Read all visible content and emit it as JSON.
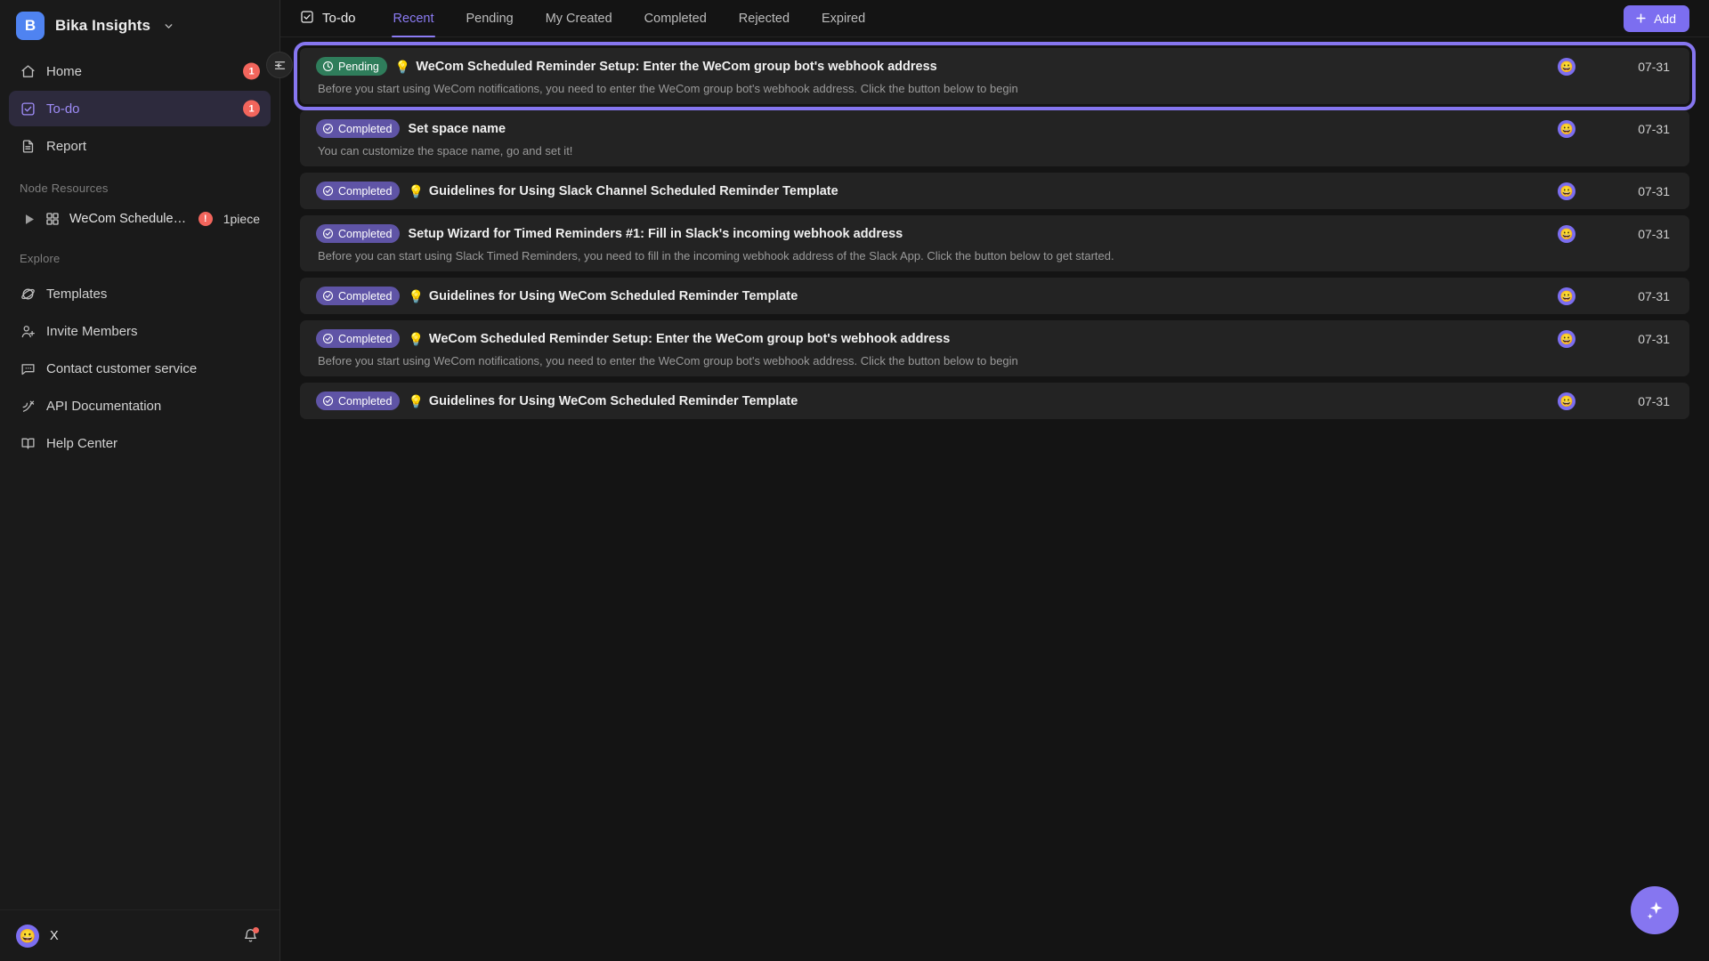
{
  "workspace": {
    "logo_letter": "B",
    "name": "Bika Insights",
    "caret_icon": "chevron-down-icon"
  },
  "sidebar": {
    "nav": [
      {
        "label": "Home",
        "icon": "home-icon",
        "badge": "1",
        "active": false
      },
      {
        "label": "To-do",
        "icon": "checkbox-icon",
        "badge": "1",
        "active": true
      },
      {
        "label": "Report",
        "icon": "document-icon",
        "badge": "",
        "active": false
      }
    ],
    "node_resources": {
      "label": "Node Resources",
      "items": [
        {
          "name": "WeCom Scheduled...",
          "alert": "!",
          "count": "1piece",
          "caret_icon": "caret-right-icon",
          "icon": "grid-icon"
        }
      ]
    },
    "explore": {
      "label": "Explore",
      "items": [
        {
          "label": "Templates",
          "icon": "template-icon"
        },
        {
          "label": "Invite Members",
          "icon": "user-plus-icon"
        },
        {
          "label": "Contact customer service",
          "icon": "chat-icon"
        },
        {
          "label": "API Documentation",
          "icon": "api-icon"
        },
        {
          "label": "Help Center",
          "icon": "book-icon"
        }
      ]
    },
    "user": {
      "avatar_emoji": "😀",
      "name": "X",
      "bell_icon": "bell-icon",
      "has_notification": true
    },
    "collapse_icon": "collapse-sidebar-icon"
  },
  "topbar": {
    "title": "To-do",
    "title_icon": "checkbox-icon",
    "tabs": [
      {
        "label": "Recent",
        "active": true
      },
      {
        "label": "Pending",
        "active": false
      },
      {
        "label": "My Created",
        "active": false
      },
      {
        "label": "Completed",
        "active": false
      },
      {
        "label": "Rejected",
        "active": false
      },
      {
        "label": "Expired",
        "active": false
      }
    ],
    "add_label": "Add",
    "add_icon": "plus-icon"
  },
  "tasks": [
    {
      "status": "Pending",
      "status_type": "pending",
      "emoji": "💡",
      "title": "WeCom Scheduled Reminder Setup: Enter the WeCom group bot's webhook address",
      "desc": "Before you start using WeCom notifications, you need to enter the WeCom group bot's webhook address. Click the button below to begin",
      "avatar_emoji": "😀",
      "date": "07-31",
      "highlighted": true
    },
    {
      "status": "Completed",
      "status_type": "completed",
      "emoji": "",
      "title": "Set space name",
      "desc": "You can customize the space name, go and set it!",
      "avatar_emoji": "😀",
      "date": "07-31",
      "highlighted": false
    },
    {
      "status": "Completed",
      "status_type": "completed",
      "emoji": "💡",
      "title": "Guidelines for Using Slack Channel Scheduled Reminder Template",
      "desc": "",
      "avatar_emoji": "😀",
      "date": "07-31",
      "highlighted": false
    },
    {
      "status": "Completed",
      "status_type": "completed",
      "emoji": "",
      "title": "Setup Wizard for Timed Reminders #1: Fill in Slack's incoming webhook address",
      "desc": "Before you can start using Slack Timed Reminders, you need to fill in the incoming webhook address of the Slack App. Click the button below to get started.",
      "avatar_emoji": "😀",
      "date": "07-31",
      "highlighted": false
    },
    {
      "status": "Completed",
      "status_type": "completed",
      "emoji": "💡",
      "title": "Guidelines for Using WeCom Scheduled Reminder Template",
      "desc": "",
      "avatar_emoji": "😀",
      "date": "07-31",
      "highlighted": false
    },
    {
      "status": "Completed",
      "status_type": "completed",
      "emoji": "💡",
      "title": "WeCom Scheduled Reminder Setup: Enter the WeCom group bot's webhook address",
      "desc": "Before you start using WeCom notifications, you need to enter the WeCom group bot's webhook address. Click the button below to begin",
      "avatar_emoji": "😀",
      "date": "07-31",
      "highlighted": false
    },
    {
      "status": "Completed",
      "status_type": "completed",
      "emoji": "💡",
      "title": "Guidelines for Using WeCom Scheduled Reminder Template",
      "desc": "",
      "avatar_emoji": "😀",
      "date": "07-31",
      "highlighted": false
    }
  ],
  "fab": {
    "icon": "sparkle-ai-icon"
  },
  "colors": {
    "accent": "#7c6ef0",
    "accent_text": "#8b7bf3",
    "badge_pending": "#2f7d5b",
    "badge_completed": "#5f54a6",
    "alert": "#f2655c",
    "logo": "#4f83f1",
    "bg": "#141414",
    "sidebar_bg": "#1a1a1a",
    "row_bg": "#232323"
  }
}
